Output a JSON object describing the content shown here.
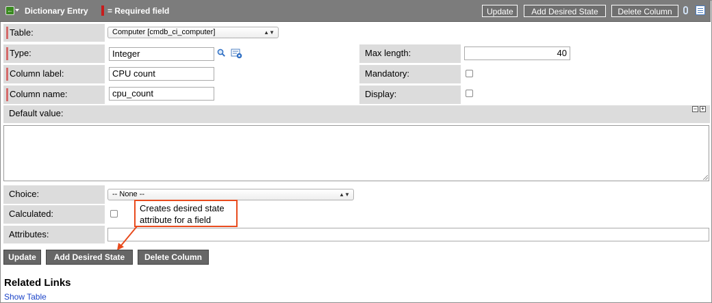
{
  "header": {
    "title": "Dictionary Entry",
    "required_legend": "= Required field",
    "buttons": [
      "Update",
      "Add Desired State",
      "Delete Column"
    ]
  },
  "form": {
    "table": {
      "label": "Table:",
      "value": "Computer [cmdb_ci_computer]"
    },
    "type": {
      "label": "Type:",
      "value": "Integer"
    },
    "max_length": {
      "label": "Max length:",
      "value": "40"
    },
    "column_label": {
      "label": "Column label:",
      "value": "CPU count"
    },
    "mandatory": {
      "label": "Mandatory:"
    },
    "column_name": {
      "label": "Column name:",
      "value": "cpu_count"
    },
    "display": {
      "label": "Display:"
    },
    "default_value": {
      "label": "Default value:"
    },
    "choice": {
      "label": "Choice:",
      "value": "-- None --"
    },
    "calculated": {
      "label": "Calculated:"
    },
    "attributes": {
      "label": "Attributes:",
      "value": ""
    }
  },
  "callout": {
    "line1": "Creates desired state",
    "line2": "attribute for a field"
  },
  "bottom_buttons": {
    "update": "Update",
    "add_desired_state": "Add Desired State",
    "delete_column": "Delete Column"
  },
  "related_links": {
    "title": "Related Links",
    "show_table": "Show Table"
  },
  "colors": {
    "header_bg": "#7c7c7c",
    "label_bg": "#dcdcdc",
    "required_marker": "#c81c1c",
    "callout_border": "#e84a1c",
    "link": "#1a43c8"
  }
}
